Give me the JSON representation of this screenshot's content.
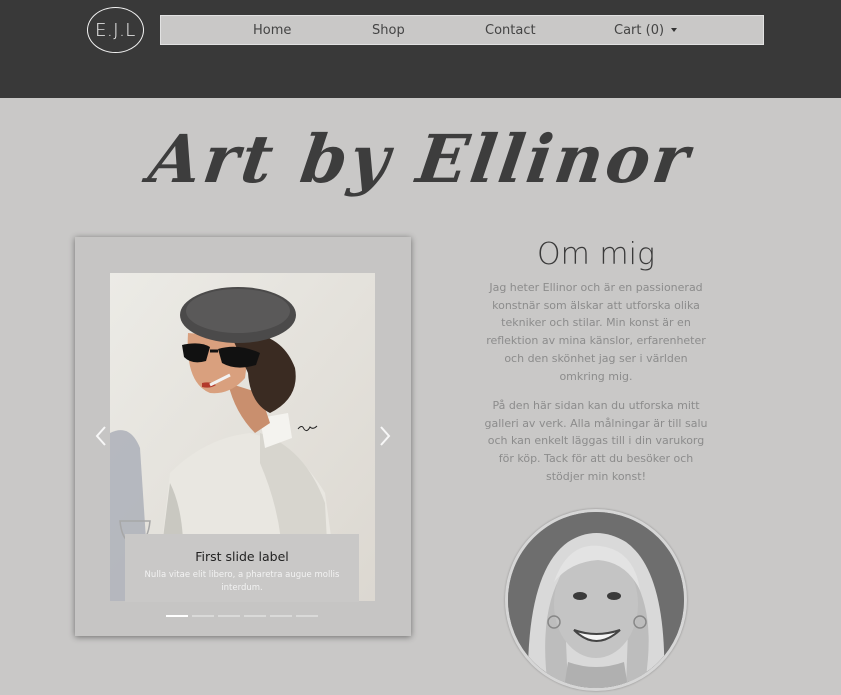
{
  "brand": {
    "logo_text": "E.J.L"
  },
  "nav": {
    "items": [
      {
        "label": "Home"
      },
      {
        "label": "Shop"
      },
      {
        "label": "Contact"
      }
    ],
    "cart_label": "Cart (0)"
  },
  "hero": {
    "title": "Art by Ellinor"
  },
  "carousel": {
    "caption_title": "First slide label",
    "caption_text": "Nulla vitae elit libero, a pharetra augue mollis interdum.",
    "slide_count": 6,
    "active_index": 0,
    "prev_icon": "chevron-left-icon",
    "next_icon": "chevron-right-icon"
  },
  "about": {
    "heading": "Om mig",
    "paragraph_1": "Jag heter Ellinor och är en passionerad konstnär som älskar att utforska olika tekniker och stilar. Min konst är en reflektion av mina känslor, erfarenheter och den skönhet jag ser i världen omkring mig.",
    "paragraph_2": "På den här sidan kan du utforska mitt galleri av verk. Alla målningar är till salu och kan enkelt läggas till i din varukorg för köp. Tack för att du besöker och stödjer min konst!"
  },
  "colors": {
    "header_bg": "#393939",
    "page_bg": "#c9c8c7",
    "text_muted": "#8c8c8c"
  }
}
